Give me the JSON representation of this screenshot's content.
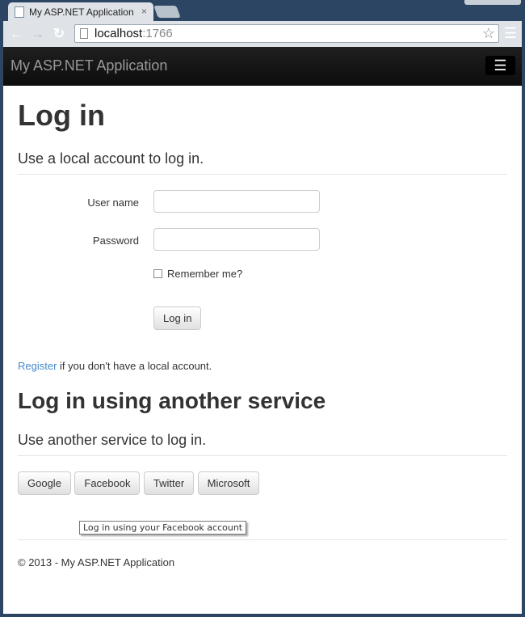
{
  "browser": {
    "tab_title": "My ASP.NET Application",
    "tab_close": "×",
    "url_host": "localhost",
    "url_port": ":1766"
  },
  "navbar": {
    "brand": "My ASP.NET Application",
    "toggle": "☰"
  },
  "login": {
    "title": "Log in",
    "subtitle": "Use a local account to log in.",
    "username_label": "User name",
    "username_value": "",
    "password_label": "Password",
    "password_value": "",
    "remember_label": "Remember me?",
    "submit": "Log in",
    "register_link": "Register",
    "register_text": " if you don't have a local account."
  },
  "external": {
    "title": "Log in using another service",
    "subtitle": "Use another service to log in.",
    "buttons": [
      "Google",
      "Facebook",
      "Twitter",
      "Microsoft"
    ],
    "tooltip": "Log in using your Facebook account"
  },
  "footer": {
    "text": "© 2013 - My ASP.NET Application"
  }
}
